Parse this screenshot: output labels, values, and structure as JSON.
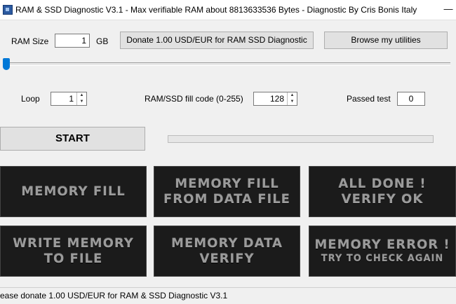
{
  "window": {
    "title": "RAM & SSD Diagnostic V3.1 - Max verifiable RAM about 8813633536 Bytes - Diagnostic By Cris Bonis Italy",
    "minimize_glyph": "—"
  },
  "controls": {
    "ram_size_label": "RAM Size",
    "ram_size_value": "1",
    "ram_unit": "GB",
    "donate_button": "Donate 1.00 USD/EUR for RAM  SSD Diagnostic",
    "browse_button": "Browse my utilities",
    "slider_value": 0,
    "loop_label": "Loop",
    "loop_value": "1",
    "fill_code_label": "RAM/SSD fill code (0-255)",
    "fill_code_value": "128",
    "passed_label": "Passed test",
    "passed_value": "0",
    "start_button": "START",
    "progress": 0
  },
  "tiles": [
    {
      "line1": "MEMORY FILL",
      "line2": ""
    },
    {
      "line1": "MEMORY FILL",
      "line2": "FROM DATA FILE"
    },
    {
      "line1": "ALL DONE !",
      "line2": "VERIFY OK"
    },
    {
      "line1": "WRITE MEMORY",
      "line2": "TO FILE"
    },
    {
      "line1": "MEMORY DATA",
      "line2": "VERIFY"
    },
    {
      "line1": "MEMORY ERROR !",
      "line2": "TRY TO CHECK AGAIN"
    }
  ],
  "statusbar": {
    "text": "ease donate 1.00 USD/EUR for RAM & SSD Diagnostic V3.1"
  },
  "colors": {
    "accent": "#0078d7",
    "tile_bg": "#1b1b1b",
    "tile_text": "#9b9b9b"
  }
}
